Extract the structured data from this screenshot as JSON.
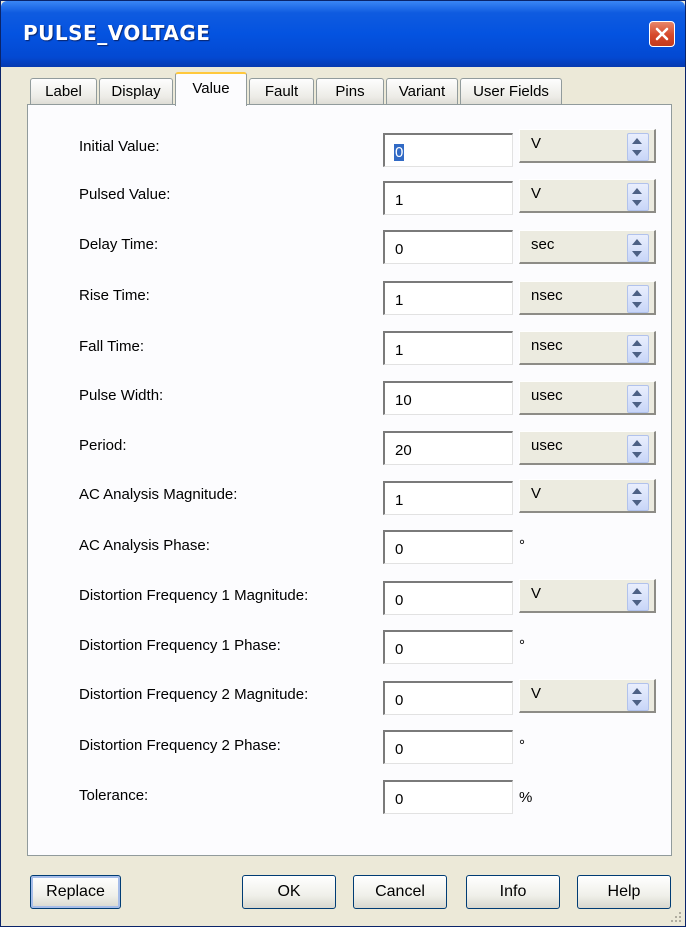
{
  "window": {
    "title": "PULSE_VOLTAGE"
  },
  "tabs": [
    "Label",
    "Display",
    "Value",
    "Fault",
    "Pins",
    "Variant",
    "User Fields"
  ],
  "active_tab": "Value",
  "fields": [
    {
      "label": "Initial Value:",
      "value": "0",
      "unit": "V"
    },
    {
      "label": "Pulsed Value:",
      "value": "1",
      "unit": "V"
    },
    {
      "label": "Delay Time:",
      "value": "0",
      "unit": "sec"
    },
    {
      "label": "Rise Time:",
      "value": "1",
      "unit": "nsec"
    },
    {
      "label": "Fall Time:",
      "value": "1",
      "unit": "nsec"
    },
    {
      "label": "Pulse Width:",
      "value": "10",
      "unit": "usec"
    },
    {
      "label": "Period:",
      "value": "20",
      "unit": "usec"
    },
    {
      "label": "AC Analysis Magnitude:",
      "value": "1",
      "unit": "V"
    },
    {
      "label": "AC Analysis Phase:",
      "value": "0",
      "suffix": "°"
    },
    {
      "label": "Distortion Frequency 1 Magnitude:",
      "value": "0",
      "unit": "V"
    },
    {
      "label": "Distortion Frequency 1 Phase:",
      "value": "0",
      "suffix": "°"
    },
    {
      "label": "Distortion Frequency 2 Magnitude:",
      "value": "0",
      "unit": "V"
    },
    {
      "label": "Distortion Frequency 2 Phase:",
      "value": "0",
      "suffix": "°"
    },
    {
      "label": "Tolerance:",
      "value": "0",
      "suffix": "%"
    }
  ],
  "buttons": {
    "replace": "Replace",
    "ok": "OK",
    "cancel": "Cancel",
    "info": "Info",
    "help": "Help"
  },
  "colors": {
    "title_bar": "#0453e0",
    "selection": "#316ac5",
    "active_tab_accent": "#ffc83c",
    "close_button": "#d6482a"
  }
}
